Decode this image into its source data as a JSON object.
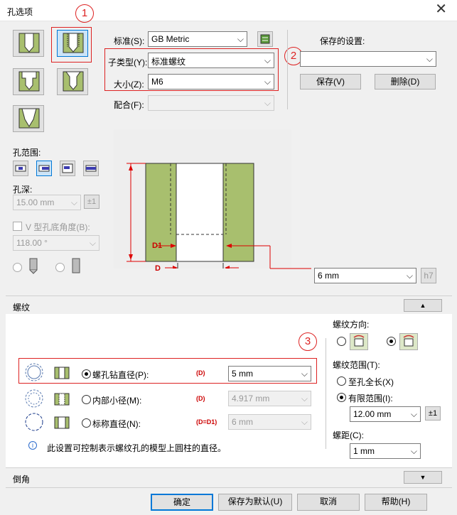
{
  "window": {
    "title": "孔选项",
    "close_glyph": "✕"
  },
  "markers": [
    "1",
    "2",
    "3"
  ],
  "spec": {
    "standard_label": "标准(S):",
    "standard_value": "GB Metric",
    "subtype_label": "子类型(Y):",
    "subtype_value": "标准螺纹",
    "size_label": "大小(Z):",
    "size_value": "M6",
    "fit_label": "配合(F):",
    "fit_value": ""
  },
  "saved": {
    "label": "保存的设置:",
    "value": "",
    "save_button": "保存(V)",
    "delete_button": "删除(D)"
  },
  "hole_extent": {
    "label": "孔范围:"
  },
  "hole_depth": {
    "label": "孔深:",
    "value": "15.00 mm",
    "toggle": "±1"
  },
  "vbottom": {
    "label": "V 型孔底角度(B):",
    "value": "118.00 °"
  },
  "diagram": {
    "d1_label": "D1",
    "d_label": "D",
    "value": "6 mm",
    "tol_button": "h7"
  },
  "thread_section": {
    "title": "螺纹"
  },
  "thread": {
    "direction_label": "螺纹方向:",
    "range_label": "螺纹范围(T):",
    "full_length_label": "至孔全长(X)",
    "finite_range_label": "有限范围(I):",
    "range_value": "12.00 mm",
    "range_toggle": "±1",
    "pitch_label": "螺距(C):",
    "pitch_value": "1 mm"
  },
  "diameter": {
    "rows": [
      {
        "label": "螺孔钻直径(P):",
        "symbol": "(D)",
        "value": "5 mm"
      },
      {
        "label": "内部小径(M):",
        "symbol": "(D)",
        "value": "4.917 mm"
      },
      {
        "label": "标称直径(N):",
        "symbol": "(D=D1)",
        "value": "6 mm"
      }
    ],
    "info_text": "此设置可控制表示螺纹孔的模型上圆柱的直径。"
  },
  "chamfer_section": {
    "title": "倒角"
  },
  "footer": {
    "ok": "确定",
    "save_default": "保存为默认(U)",
    "cancel": "取消",
    "help": "帮助(H)"
  },
  "colors": {
    "accent": "#0078d7",
    "annotation_red": "#dd2222",
    "hatch_green": "#a8bf6e"
  }
}
